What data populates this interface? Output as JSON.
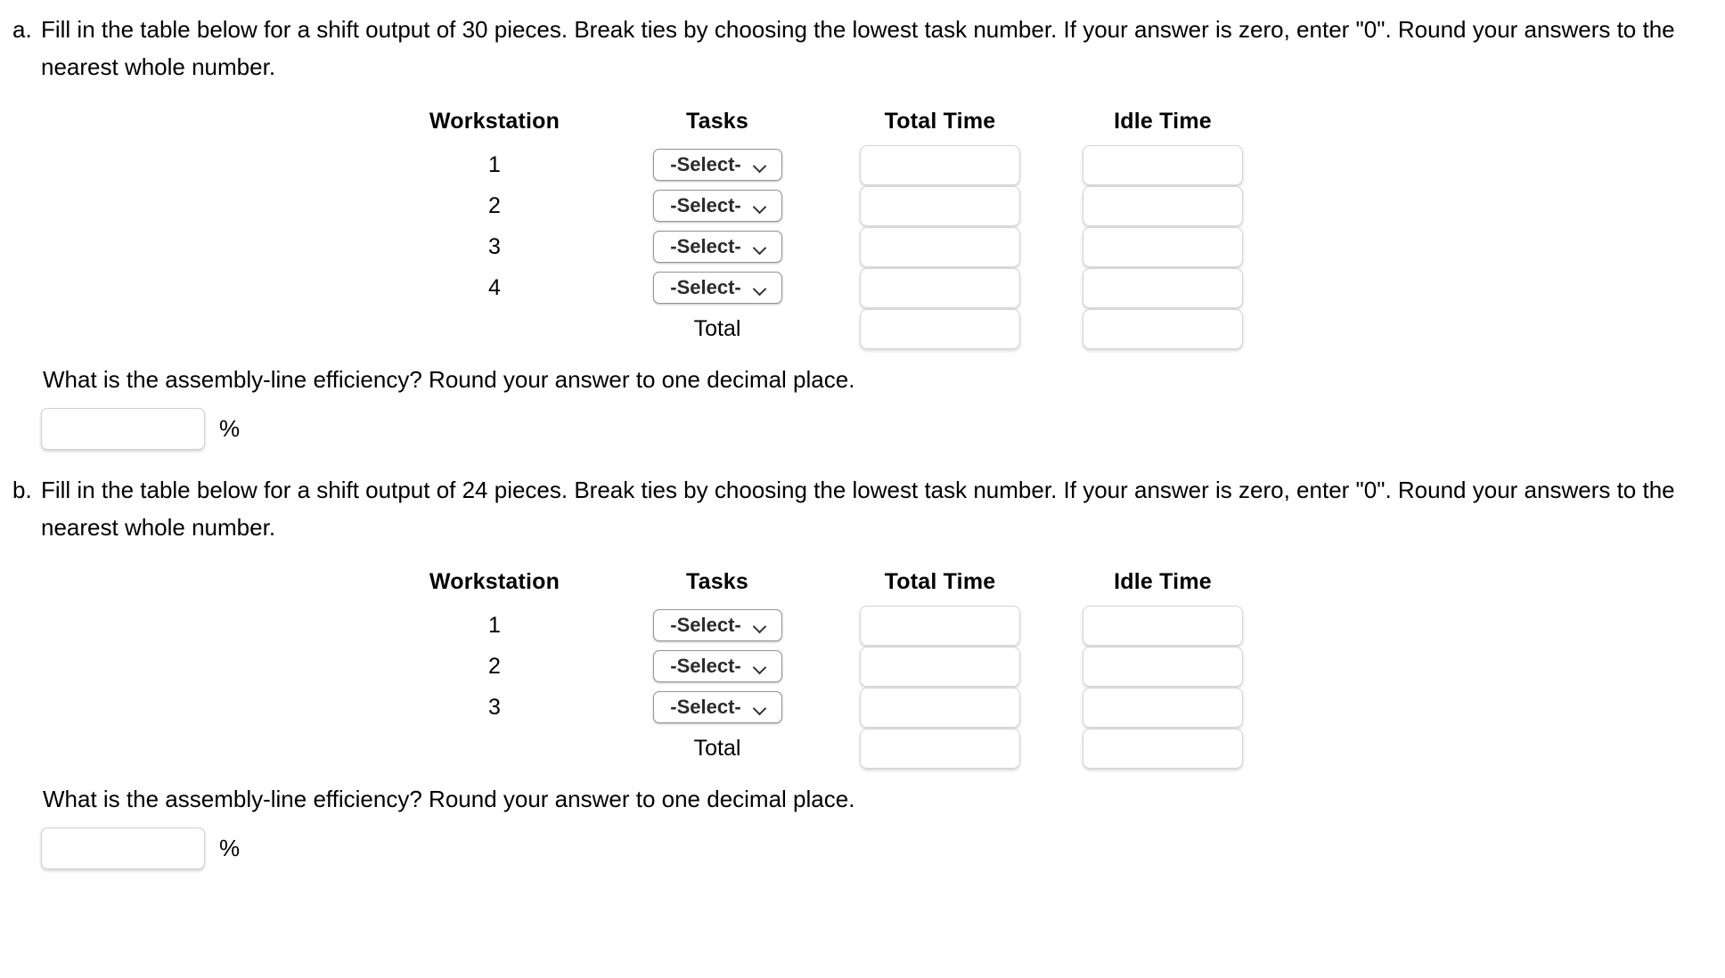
{
  "document": {
    "background": "#ffffff",
    "text_color": "#000000"
  },
  "parts": [
    {
      "letter": "a.",
      "prompt": "Fill in the table below for a shift output of 30 pieces. Break ties by choosing the lowest task number. If your answer is zero, enter \"0\". Round your answers to the nearest whole number.",
      "table": {
        "headers": {
          "workstation": "Workstation",
          "tasks": "Tasks",
          "total_time": "Total Time",
          "idle_time": "Idle Time"
        },
        "rows": [
          {
            "workstation": "1",
            "tasks_value": "-Select-",
            "total_time": "",
            "idle_time": ""
          },
          {
            "workstation": "2",
            "tasks_value": "-Select-",
            "total_time": "",
            "idle_time": ""
          },
          {
            "workstation": "3",
            "tasks_value": "-Select-",
            "total_time": "",
            "idle_time": ""
          },
          {
            "workstation": "4",
            "tasks_value": "-Select-",
            "total_time": "",
            "idle_time": ""
          }
        ],
        "total_row": {
          "label": "Total",
          "total_time": "",
          "idle_time": ""
        }
      },
      "efficiency": {
        "question": "What is the assembly-line efficiency? Round your answer to one decimal place.",
        "value": "",
        "unit": "%"
      }
    },
    {
      "letter": "b.",
      "prompt": "Fill in the table below for a shift output of 24 pieces. Break ties by choosing the lowest task number. If your answer is zero, enter \"0\". Round your answers to the nearest whole number.",
      "table": {
        "headers": {
          "workstation": "Workstation",
          "tasks": "Tasks",
          "total_time": "Total Time",
          "idle_time": "Idle Time"
        },
        "rows": [
          {
            "workstation": "1",
            "tasks_value": "-Select-",
            "total_time": "",
            "idle_time": ""
          },
          {
            "workstation": "2",
            "tasks_value": "-Select-",
            "total_time": "",
            "idle_time": ""
          },
          {
            "workstation": "3",
            "tasks_value": "-Select-",
            "total_time": "",
            "idle_time": ""
          }
        ],
        "total_row": {
          "label": "Total",
          "total_time": "",
          "idle_time": ""
        }
      },
      "efficiency": {
        "question": "What is the assembly-line efficiency? Round your answer to one decimal place.",
        "value": "",
        "unit": "%"
      }
    }
  ],
  "icons": {
    "chevron_down": "chevron-down-icon"
  }
}
